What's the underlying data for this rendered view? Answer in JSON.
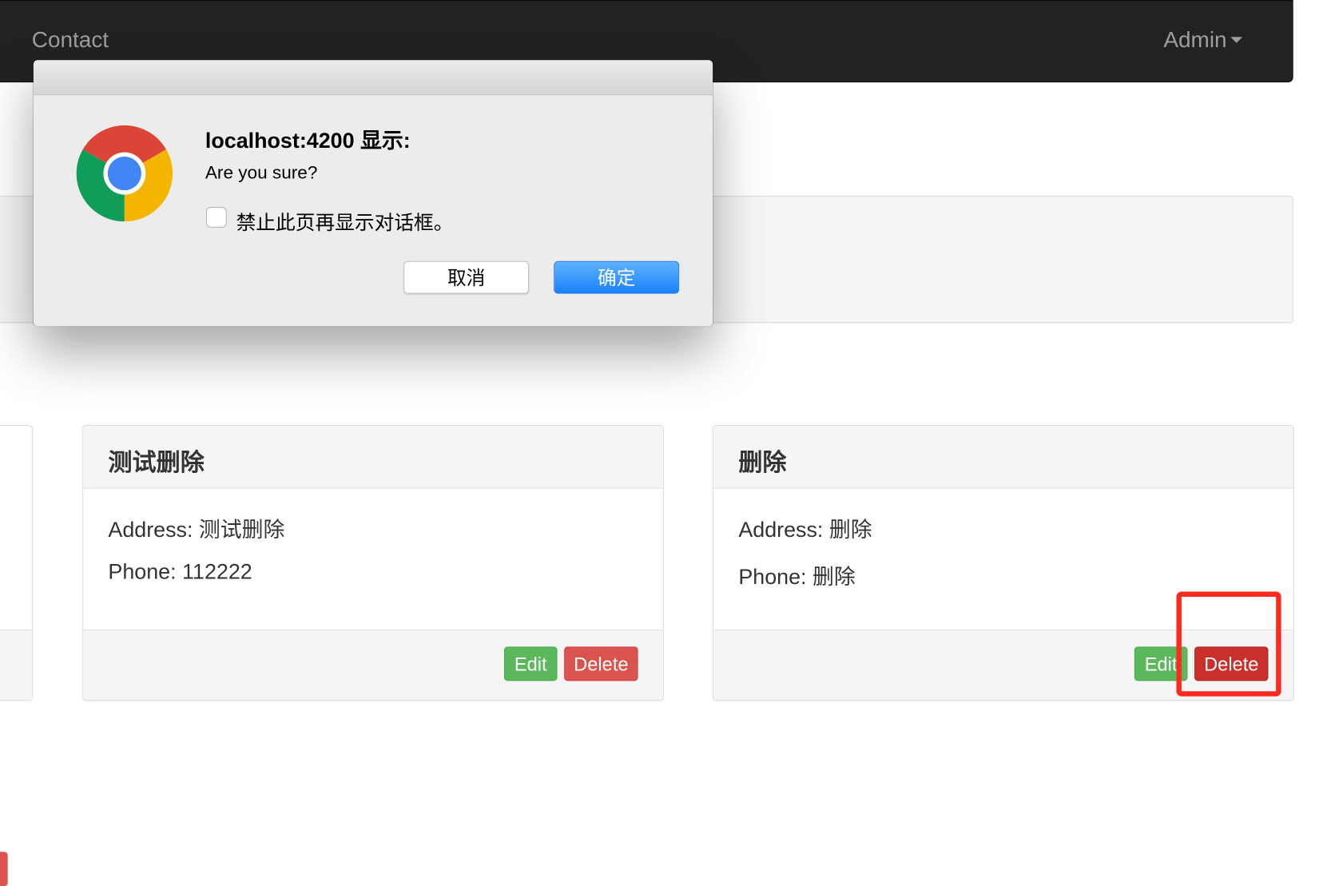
{
  "navbar": {
    "brand_link": "Contact",
    "admin_menu": "Admin"
  },
  "cards": [
    {
      "title": "测试删除",
      "address_line": "Address: 测试删除",
      "phone_line": "Phone: 112222",
      "edit_label": "Edit",
      "delete_label": "Delete"
    },
    {
      "title": "删除",
      "address_line": "Address: 删除",
      "phone_line": "Phone: 删除",
      "edit_label": "Edit",
      "delete_label": "Delete"
    }
  ],
  "dialog": {
    "heading": "localhost:4200 显示:",
    "message": "Are you sure?",
    "checkbox_label": "禁止此页再显示对话框。",
    "checkbox_checked": false,
    "cancel_label": "取消",
    "ok_label": "确定",
    "icon": "chrome-logo"
  },
  "colors": {
    "navbar_bg": "#222222",
    "edit_button": "#5cb85c",
    "delete_button": "#d9534f",
    "dialog_ok_button": "#1a82fb",
    "highlight_box": "#ff2a1f"
  }
}
